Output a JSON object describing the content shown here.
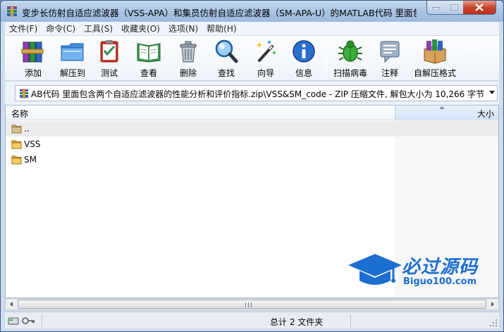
{
  "window": {
    "title": "变步长仿射自适应滤波器（VSS-APA）和集员仿射自适应滤波器（SM-APA-U）的MATLAB代码 里面包..."
  },
  "menu": [
    {
      "label": "文件(F)"
    },
    {
      "label": "命令(C)"
    },
    {
      "label": "工具(S)"
    },
    {
      "label": "收藏夹(O)"
    },
    {
      "label": "选项(N)"
    },
    {
      "label": "帮助(H)"
    }
  ],
  "toolbar": [
    {
      "label": "添加",
      "icon": "add-books-icon"
    },
    {
      "label": "解压到",
      "icon": "extract-folder-icon"
    },
    {
      "label": "测试",
      "icon": "test-checklist-icon"
    },
    {
      "label": "查看",
      "icon": "view-book-icon"
    },
    {
      "label": "删除",
      "icon": "trash-icon"
    },
    {
      "label": "查找",
      "icon": "magnifier-icon"
    },
    {
      "label": "向导",
      "icon": "wizard-wand-icon"
    },
    {
      "label": "信息",
      "icon": "info-icon"
    },
    {
      "label": "扫描病毒",
      "icon": "virus-scan-icon"
    },
    {
      "label": "注释",
      "icon": "comment-icon"
    },
    {
      "label": "自解压格式",
      "icon": "sfx-box-icon"
    }
  ],
  "address": {
    "text": "AB代码 里面包含两个自适应滤波器的性能分析和评价指标.zip\\VSS&SM_code - ZIP 压缩文件, 解包大小为 10,266 字节"
  },
  "list": {
    "columns": {
      "name": "名称",
      "size": "大小"
    },
    "rows": [
      {
        "name": "..",
        "type": "parent"
      },
      {
        "name": "VSS",
        "type": "folder"
      },
      {
        "name": "SM",
        "type": "folder"
      }
    ]
  },
  "watermark": {
    "title": "必过源码",
    "subtitle": "Biguo100.com"
  },
  "status": {
    "text": "总计 2 文件夹"
  },
  "colors": {
    "accent": "#1c6fd1",
    "titlebar": "#a9c3e2",
    "close": "#c9462c",
    "folder": "#e9b949"
  }
}
